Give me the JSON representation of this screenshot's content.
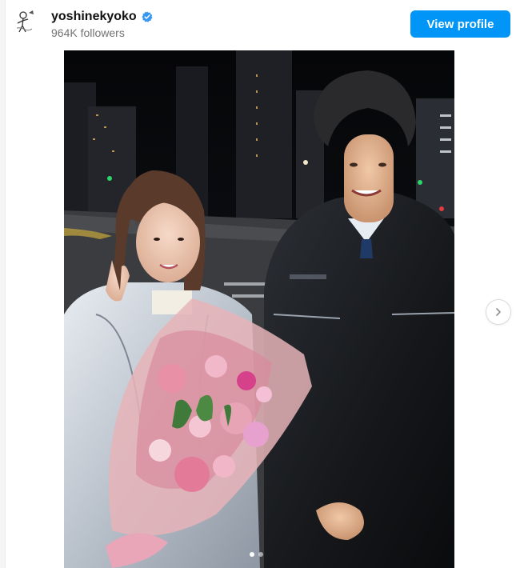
{
  "profile": {
    "username": "yoshinekyoko",
    "followers": "964K followers",
    "avatar_icon": "sketch-figure-avatar",
    "verified_icon": "verified-badge-icon",
    "verified_color": "#3897f0"
  },
  "header": {
    "view_profile_label": "View profile",
    "button_color": "#0095f6"
  },
  "post": {
    "image_subject": "two people at night holding a pink bouquet",
    "carousel_count": 2,
    "carousel_active": 1,
    "next_icon": "chevron-right-icon"
  }
}
